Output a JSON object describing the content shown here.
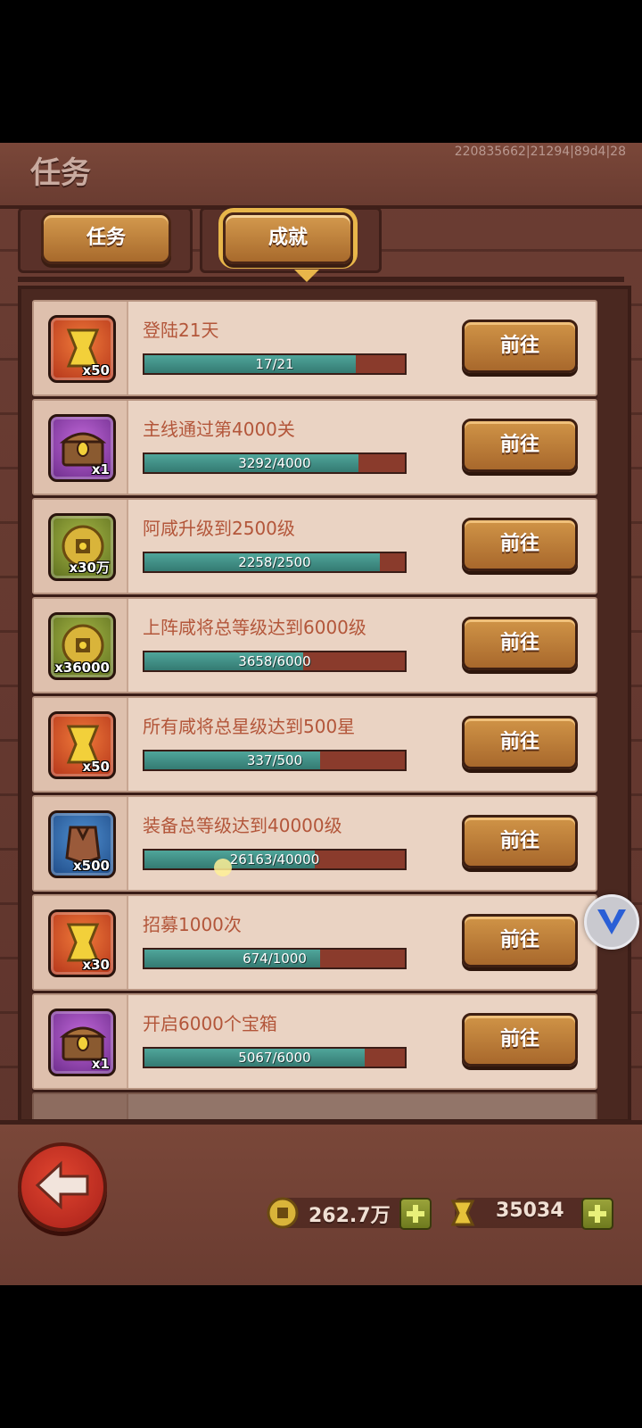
{
  "header": {
    "title": "任务",
    "build_info": "220835662|21294|89d4|28"
  },
  "tabs": [
    {
      "label": "任务",
      "active": false
    },
    {
      "label": "成就",
      "active": true
    }
  ],
  "achievements": [
    {
      "title": "登陆21天",
      "progress_text": "17/21",
      "progress": 0.81,
      "reward_icon": "scroll-icon",
      "reward_color": "red",
      "reward_qty": "x50",
      "button": "前往"
    },
    {
      "title": "主线通过第4000关",
      "progress_text": "3292/4000",
      "progress": 0.823,
      "reward_icon": "treasure-chest-icon",
      "reward_color": "purple",
      "reward_qty": "x1",
      "button": "前往"
    },
    {
      "title": "阿咸升级到2500级",
      "progress_text": "2258/2500",
      "progress": 0.903,
      "reward_icon": "coin-icon",
      "reward_color": "green",
      "reward_qty": "x30万",
      "button": "前往"
    },
    {
      "title": "上阵咸将总等级达到6000级",
      "progress_text": "3658/6000",
      "progress": 0.61,
      "reward_icon": "coin-icon",
      "reward_color": "green",
      "reward_qty": "x36000",
      "button": "前往"
    },
    {
      "title": "所有咸将总星级达到500星",
      "progress_text": "337/500",
      "progress": 0.674,
      "reward_icon": "scroll-icon",
      "reward_color": "red",
      "reward_qty": "x50",
      "button": "前往"
    },
    {
      "title": "装备总等级达到40000级",
      "progress_text": "26163/40000",
      "progress": 0.654,
      "reward_icon": "armor-icon",
      "reward_color": "blue",
      "reward_qty": "x500",
      "button": "前往"
    },
    {
      "title": "招募1000次",
      "progress_text": "674/1000",
      "progress": 0.674,
      "reward_icon": "scroll-icon",
      "reward_color": "red",
      "reward_qty": "x30",
      "button": "前往"
    },
    {
      "title": "开启6000个宝箱",
      "progress_text": "5067/6000",
      "progress": 0.845,
      "reward_icon": "treasure-chest-icon",
      "reward_color": "purple",
      "reward_qty": "x1",
      "button": "前往"
    }
  ],
  "footer": {
    "coins": "262.7万",
    "scrolls": "35034"
  }
}
